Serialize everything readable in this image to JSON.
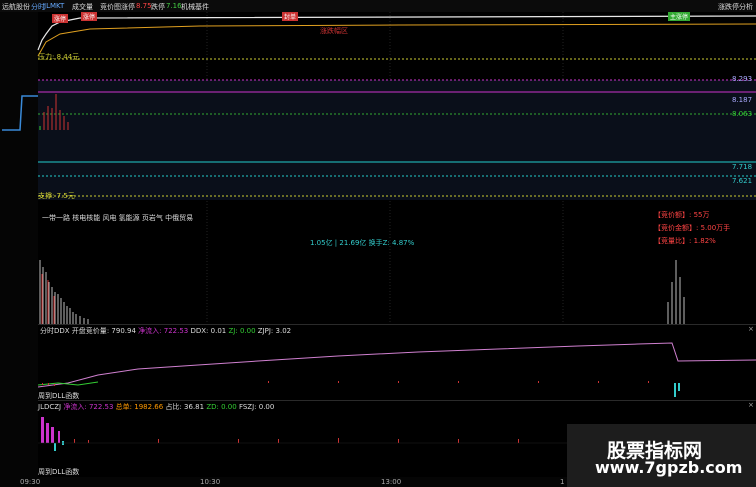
{
  "header": {
    "stock_name": "远航股份",
    "tabs": [
      "分时",
      "JLMKT",
      "成交量",
      "竞价图"
    ],
    "limit_up_label": "涨停",
    "limit_up_value": "8.75",
    "limit_down_label": "跌停",
    "limit_down_value": "7.16",
    "sector": "机械基件",
    "right_label": "涨跌停分析"
  },
  "main_chart": {
    "tags": {
      "zhangting": "涨停",
      "fengdan": "封单",
      "zhuyi": "主涨停"
    },
    "text_center": "涨跌幅区",
    "pressure_label": "压力: 8.44元",
    "support_label": "支撑: 7.5元",
    "price_levels": [
      "8.293",
      "8.187",
      "8.063",
      "7.718",
      "7.621"
    ],
    "theme_text": "一带一路 核电核能 风电 氢能源 页岩气 中俄贸易",
    "right_box": [
      "【竞价额】: 55万",
      "【竞价金额】: 5.00万手",
      "【竞量比】: 1.82%"
    ],
    "status_line": "1.05亿 | 21.69亿 换手Z: 4.87%",
    "colors": {
      "price_line": "#e8e8e8",
      "avg_line": "#e0a020",
      "pressure": "#cccc33",
      "magenta": "#cc33cc",
      "cyan": "#22cccc",
      "grid": "#333"
    }
  },
  "panel1": {
    "title": "分时DDX",
    "items": [
      {
        "label": "开盘竞价量",
        "value": "790.94"
      },
      {
        "label": "净流入",
        "value": "722.53"
      },
      {
        "label": "DDX",
        "value": "0.01"
      },
      {
        "label": "ZJ",
        "value": "0.00"
      },
      {
        "label": "ZJPJ",
        "value": "3.02"
      }
    ],
    "footer": "周到DLL函数"
  },
  "panel2": {
    "title": "JLDCZJ",
    "items": [
      {
        "label": "净流入",
        "value": "722.53"
      },
      {
        "label": "总单",
        "value": "1982.66"
      },
      {
        "label": "占比",
        "value": "36.81"
      },
      {
        "label": "ZD",
        "value": "0.00"
      },
      {
        "label": "FSZJ",
        "value": "0.00"
      }
    ],
    "footer": "周到DLL函数"
  },
  "x_axis": [
    "09:30",
    "10:30",
    "13:00",
    "1"
  ],
  "watermark": {
    "line1": "股票指标网",
    "line2": "www.7gpzb.com"
  }
}
